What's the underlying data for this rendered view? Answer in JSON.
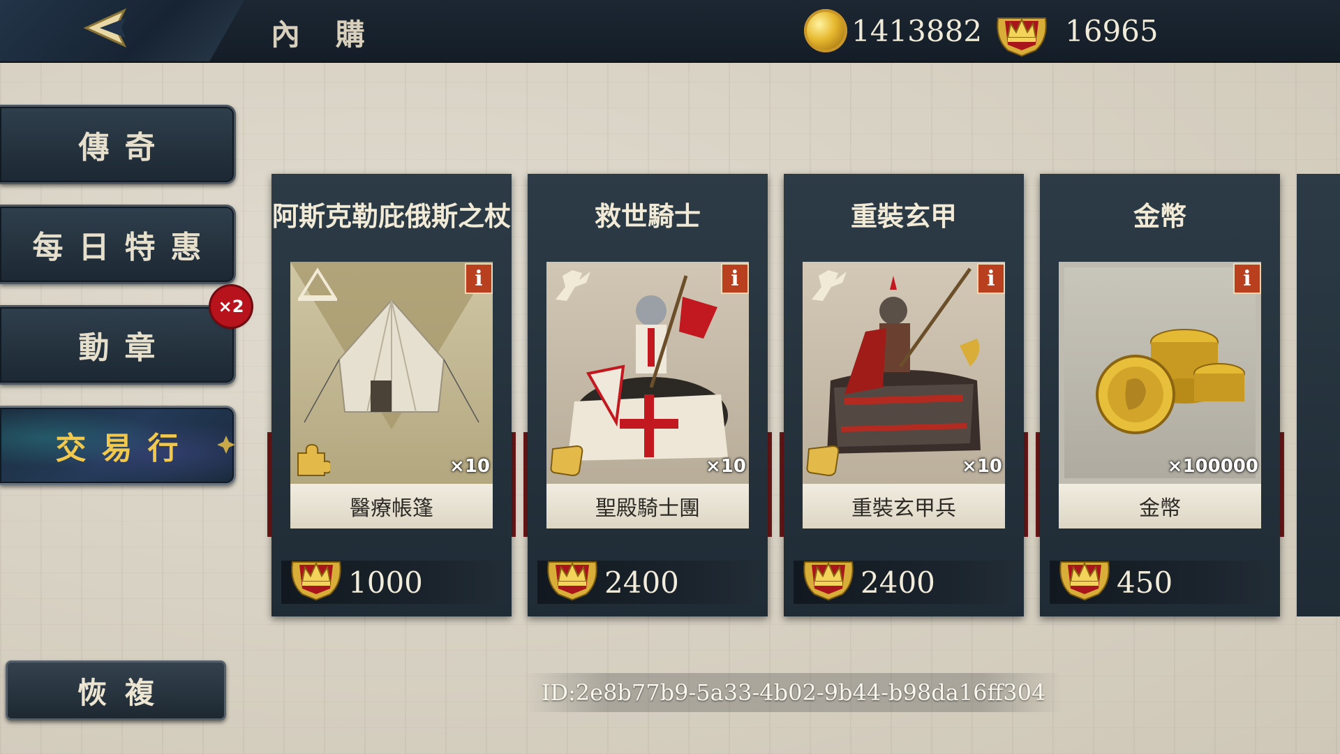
{
  "header": {
    "title": "內 購",
    "gold_amount": "1413882",
    "crown_amount": "16965"
  },
  "sidebar": {
    "items": [
      {
        "label": "傳奇"
      },
      {
        "label": "每日特惠"
      },
      {
        "label": "動章"
      },
      {
        "label": "交易行"
      }
    ],
    "badge_text": "×2",
    "restore_label": "恢複"
  },
  "shop": {
    "cards": [
      {
        "title": "阿斯克勒庇俄斯之杖",
        "item_name": "醫療帳篷",
        "quantity": "×10",
        "price": "1000",
        "info": "i"
      },
      {
        "title": "救世騎士",
        "item_name": "聖殿騎士團",
        "quantity": "×10",
        "price": "2400",
        "info": "i"
      },
      {
        "title": "重裝玄甲",
        "item_name": "重裝玄甲兵",
        "quantity": "×10",
        "price": "2400",
        "info": "i"
      },
      {
        "title": "金幣",
        "item_name": "金幣",
        "quantity": "×100000",
        "price": "450",
        "info": "i"
      }
    ]
  },
  "footer": {
    "id_text": "ID:2e8b77b9-5a33-4b02-9b44-b98da16ff304"
  },
  "colors": {
    "accent_gold": "#f2c94c",
    "topbar": "#141d27",
    "card": "#2c3b46",
    "info_badge": "#b8401f",
    "ribbon_red": "#8a2020"
  }
}
